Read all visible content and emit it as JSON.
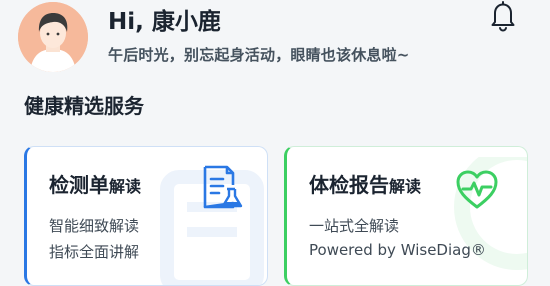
{
  "header": {
    "greeting": "Hi, 康小鹿",
    "subtitle": "午后时光，别忘起身活动，眼睛也该休息啦~"
  },
  "section": {
    "title": "健康精选服务"
  },
  "cards": [
    {
      "title_main": "检测单",
      "title_suffix": "解读",
      "line1": "智能细致解读",
      "line2": "指标全面讲解",
      "accent": "#2a78e4",
      "icon": "report-flask-icon"
    },
    {
      "title_main": "体检报告",
      "title_suffix": "解读",
      "line1": "一站式全解读",
      "line2": "Powered by WiseDiag®",
      "accent": "#3ccf62",
      "icon": "heart-pulse-icon"
    }
  ]
}
